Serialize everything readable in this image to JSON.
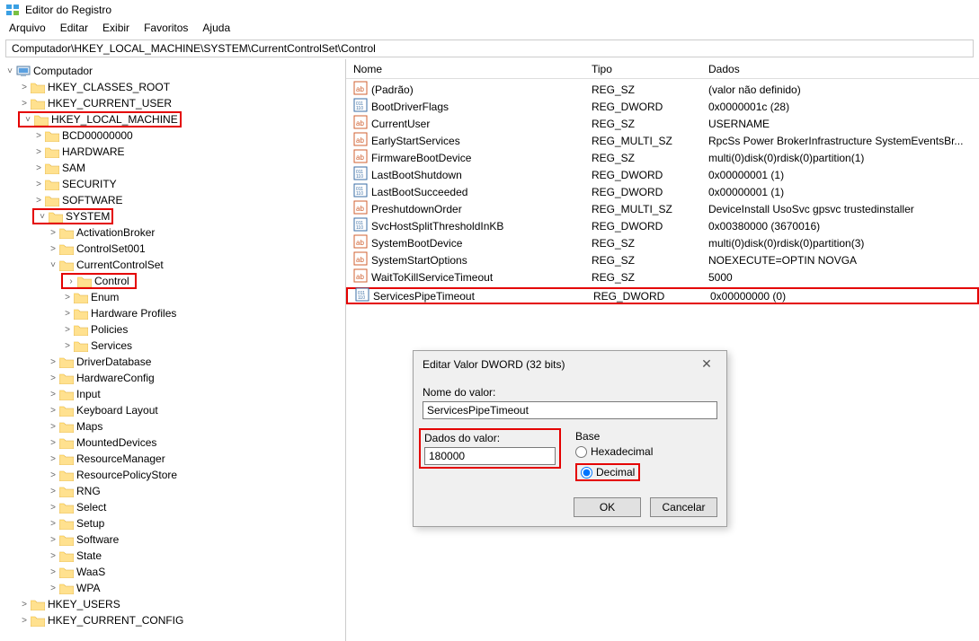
{
  "app": {
    "title": "Editor do Registro"
  },
  "menu": {
    "file": "Arquivo",
    "edit": "Editar",
    "view": "Exibir",
    "favorites": "Favoritos",
    "help": "Ajuda"
  },
  "address": "Computador\\HKEY_LOCAL_MACHINE\\SYSTEM\\CurrentControlSet\\Control",
  "tree": {
    "root": "Computador",
    "hkcr": "HKEY_CLASSES_ROOT",
    "hkcu": "HKEY_CURRENT_USER",
    "hklm": "HKEY_LOCAL_MACHINE",
    "hklm_children": [
      "BCD00000000",
      "HARDWARE",
      "SAM",
      "SECURITY",
      "SOFTWARE"
    ],
    "system": "SYSTEM",
    "system_children_before": [
      "ActivationBroker",
      "ControlSet001"
    ],
    "ccs": "CurrentControlSet",
    "control": "Control",
    "control_siblings": [
      "Enum",
      "Hardware Profiles",
      "Policies",
      "Services"
    ],
    "system_children_after": [
      "DriverDatabase",
      "HardwareConfig",
      "Input",
      "Keyboard Layout",
      "Maps",
      "MountedDevices",
      "ResourceManager",
      "ResourcePolicyStore",
      "RNG",
      "Select",
      "Setup",
      "Software",
      "State",
      "WaaS",
      "WPA"
    ],
    "hku": "HKEY_USERS",
    "hkcc": "HKEY_CURRENT_CONFIG"
  },
  "list": {
    "headers": {
      "name": "Nome",
      "type": "Tipo",
      "data": "Dados"
    },
    "rows": [
      {
        "icon": "sz",
        "name": "(Padrão)",
        "type": "REG_SZ",
        "data": "(valor não definido)"
      },
      {
        "icon": "bin",
        "name": "BootDriverFlags",
        "type": "REG_DWORD",
        "data": "0x0000001c (28)"
      },
      {
        "icon": "sz",
        "name": "CurrentUser",
        "type": "REG_SZ",
        "data": "USERNAME"
      },
      {
        "icon": "sz",
        "name": "EarlyStartServices",
        "type": "REG_MULTI_SZ",
        "data": "RpcSs Power BrokerInfrastructure SystemEventsBr..."
      },
      {
        "icon": "sz",
        "name": "FirmwareBootDevice",
        "type": "REG_SZ",
        "data": "multi(0)disk(0)rdisk(0)partition(1)"
      },
      {
        "icon": "bin",
        "name": "LastBootShutdown",
        "type": "REG_DWORD",
        "data": "0x00000001 (1)"
      },
      {
        "icon": "bin",
        "name": "LastBootSucceeded",
        "type": "REG_DWORD",
        "data": "0x00000001 (1)"
      },
      {
        "icon": "sz",
        "name": "PreshutdownOrder",
        "type": "REG_MULTI_SZ",
        "data": "DeviceInstall UsoSvc gpsvc trustedinstaller"
      },
      {
        "icon": "bin",
        "name": "SvcHostSplitThresholdInKB",
        "type": "REG_DWORD",
        "data": "0x00380000 (3670016)"
      },
      {
        "icon": "sz",
        "name": "SystemBootDevice",
        "type": "REG_SZ",
        "data": "multi(0)disk(0)rdisk(0)partition(3)"
      },
      {
        "icon": "sz",
        "name": "SystemStartOptions",
        "type": "REG_SZ",
        "data": " NOEXECUTE=OPTIN  NOVGA"
      },
      {
        "icon": "sz",
        "name": "WaitToKillServiceTimeout",
        "type": "REG_SZ",
        "data": "5000"
      },
      {
        "icon": "bin",
        "name": "ServicesPipeTimeout",
        "type": "REG_DWORD",
        "data": "0x00000000 (0)",
        "highlight": true
      }
    ]
  },
  "dialog": {
    "title": "Editar Valor DWORD (32 bits)",
    "name_label": "Nome do valor:",
    "name_value": "ServicesPipeTimeout",
    "data_label": "Dados do valor:",
    "data_value": "180000",
    "base_label": "Base",
    "hex": "Hexadecimal",
    "dec": "Decimal",
    "selected": "dec",
    "ok": "OK",
    "cancel": "Cancelar"
  }
}
